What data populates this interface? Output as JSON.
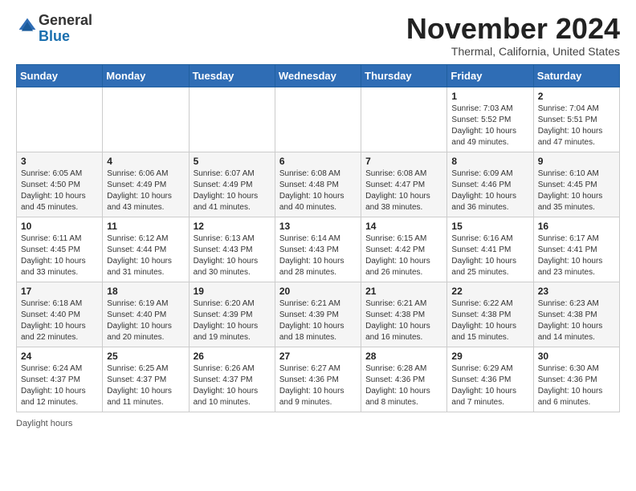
{
  "header": {
    "logo_general": "General",
    "logo_blue": "Blue",
    "month_title": "November 2024",
    "subtitle": "Thermal, California, United States"
  },
  "footer": {
    "daylight_label": "Daylight hours"
  },
  "weekdays": [
    "Sunday",
    "Monday",
    "Tuesday",
    "Wednesday",
    "Thursday",
    "Friday",
    "Saturday"
  ],
  "weeks": [
    [
      {
        "day": "",
        "info": ""
      },
      {
        "day": "",
        "info": ""
      },
      {
        "day": "",
        "info": ""
      },
      {
        "day": "",
        "info": ""
      },
      {
        "day": "",
        "info": ""
      },
      {
        "day": "1",
        "info": "Sunrise: 7:03 AM\nSunset: 5:52 PM\nDaylight: 10 hours and 49 minutes."
      },
      {
        "day": "2",
        "info": "Sunrise: 7:04 AM\nSunset: 5:51 PM\nDaylight: 10 hours and 47 minutes."
      }
    ],
    [
      {
        "day": "3",
        "info": "Sunrise: 6:05 AM\nSunset: 4:50 PM\nDaylight: 10 hours and 45 minutes."
      },
      {
        "day": "4",
        "info": "Sunrise: 6:06 AM\nSunset: 4:49 PM\nDaylight: 10 hours and 43 minutes."
      },
      {
        "day": "5",
        "info": "Sunrise: 6:07 AM\nSunset: 4:49 PM\nDaylight: 10 hours and 41 minutes."
      },
      {
        "day": "6",
        "info": "Sunrise: 6:08 AM\nSunset: 4:48 PM\nDaylight: 10 hours and 40 minutes."
      },
      {
        "day": "7",
        "info": "Sunrise: 6:08 AM\nSunset: 4:47 PM\nDaylight: 10 hours and 38 minutes."
      },
      {
        "day": "8",
        "info": "Sunrise: 6:09 AM\nSunset: 4:46 PM\nDaylight: 10 hours and 36 minutes."
      },
      {
        "day": "9",
        "info": "Sunrise: 6:10 AM\nSunset: 4:45 PM\nDaylight: 10 hours and 35 minutes."
      }
    ],
    [
      {
        "day": "10",
        "info": "Sunrise: 6:11 AM\nSunset: 4:45 PM\nDaylight: 10 hours and 33 minutes."
      },
      {
        "day": "11",
        "info": "Sunrise: 6:12 AM\nSunset: 4:44 PM\nDaylight: 10 hours and 31 minutes."
      },
      {
        "day": "12",
        "info": "Sunrise: 6:13 AM\nSunset: 4:43 PM\nDaylight: 10 hours and 30 minutes."
      },
      {
        "day": "13",
        "info": "Sunrise: 6:14 AM\nSunset: 4:43 PM\nDaylight: 10 hours and 28 minutes."
      },
      {
        "day": "14",
        "info": "Sunrise: 6:15 AM\nSunset: 4:42 PM\nDaylight: 10 hours and 26 minutes."
      },
      {
        "day": "15",
        "info": "Sunrise: 6:16 AM\nSunset: 4:41 PM\nDaylight: 10 hours and 25 minutes."
      },
      {
        "day": "16",
        "info": "Sunrise: 6:17 AM\nSunset: 4:41 PM\nDaylight: 10 hours and 23 minutes."
      }
    ],
    [
      {
        "day": "17",
        "info": "Sunrise: 6:18 AM\nSunset: 4:40 PM\nDaylight: 10 hours and 22 minutes."
      },
      {
        "day": "18",
        "info": "Sunrise: 6:19 AM\nSunset: 4:40 PM\nDaylight: 10 hours and 20 minutes."
      },
      {
        "day": "19",
        "info": "Sunrise: 6:20 AM\nSunset: 4:39 PM\nDaylight: 10 hours and 19 minutes."
      },
      {
        "day": "20",
        "info": "Sunrise: 6:21 AM\nSunset: 4:39 PM\nDaylight: 10 hours and 18 minutes."
      },
      {
        "day": "21",
        "info": "Sunrise: 6:21 AM\nSunset: 4:38 PM\nDaylight: 10 hours and 16 minutes."
      },
      {
        "day": "22",
        "info": "Sunrise: 6:22 AM\nSunset: 4:38 PM\nDaylight: 10 hours and 15 minutes."
      },
      {
        "day": "23",
        "info": "Sunrise: 6:23 AM\nSunset: 4:38 PM\nDaylight: 10 hours and 14 minutes."
      }
    ],
    [
      {
        "day": "24",
        "info": "Sunrise: 6:24 AM\nSunset: 4:37 PM\nDaylight: 10 hours and 12 minutes."
      },
      {
        "day": "25",
        "info": "Sunrise: 6:25 AM\nSunset: 4:37 PM\nDaylight: 10 hours and 11 minutes."
      },
      {
        "day": "26",
        "info": "Sunrise: 6:26 AM\nSunset: 4:37 PM\nDaylight: 10 hours and 10 minutes."
      },
      {
        "day": "27",
        "info": "Sunrise: 6:27 AM\nSunset: 4:36 PM\nDaylight: 10 hours and 9 minutes."
      },
      {
        "day": "28",
        "info": "Sunrise: 6:28 AM\nSunset: 4:36 PM\nDaylight: 10 hours and 8 minutes."
      },
      {
        "day": "29",
        "info": "Sunrise: 6:29 AM\nSunset: 4:36 PM\nDaylight: 10 hours and 7 minutes."
      },
      {
        "day": "30",
        "info": "Sunrise: 6:30 AM\nSunset: 4:36 PM\nDaylight: 10 hours and 6 minutes."
      }
    ]
  ]
}
